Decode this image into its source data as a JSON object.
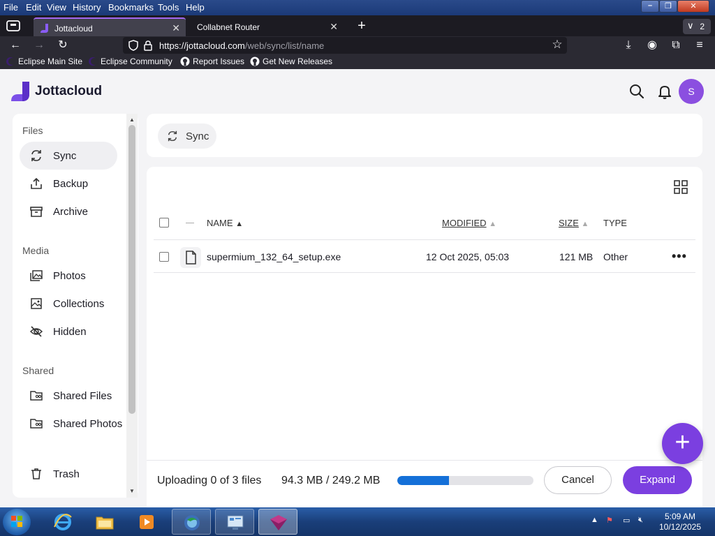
{
  "menubar": {
    "items": [
      {
        "label": "File"
      },
      {
        "label": "Edit"
      },
      {
        "label": "View"
      },
      {
        "label": "History"
      },
      {
        "label": "Bookmarks"
      },
      {
        "label": "Tools"
      },
      {
        "label": "Help"
      }
    ]
  },
  "tabs": [
    {
      "title": "Jottacloud",
      "active": true
    },
    {
      "title": "Collabnet Router",
      "active": false
    }
  ],
  "tab_count": "2",
  "urlbar": {
    "host": "https://jottacloud.com",
    "path": "/web/sync/list/name"
  },
  "bookmarks": [
    {
      "label": "Eclipse Main Site",
      "icon": "eclipse-icon"
    },
    {
      "label": "Eclipse Community",
      "icon": "eclipse-icon"
    },
    {
      "label": "Report Issues",
      "icon": "github-icon"
    },
    {
      "label": "Get New Releases",
      "icon": "github-icon"
    }
  ],
  "app": {
    "name": "Jottacloud",
    "avatar_initial": "S",
    "accent": "#7b3fe0"
  },
  "sidebar": {
    "sections": [
      {
        "title": "Files",
        "items": [
          {
            "label": "Sync",
            "icon": "sync-icon",
            "active": true
          },
          {
            "label": "Backup",
            "icon": "backup-icon"
          },
          {
            "label": "Archive",
            "icon": "archive-icon"
          }
        ]
      },
      {
        "title": "Media",
        "items": [
          {
            "label": "Photos",
            "icon": "photos-icon"
          },
          {
            "label": "Collections",
            "icon": "collections-icon"
          },
          {
            "label": "Hidden",
            "icon": "hidden-icon"
          }
        ]
      },
      {
        "title": "Shared",
        "items": [
          {
            "label": "Shared Files",
            "icon": "shared-files-icon"
          },
          {
            "label": "Shared Photos",
            "icon": "shared-photos-icon"
          }
        ]
      }
    ],
    "trash_label": "Trash"
  },
  "breadcrumb": {
    "label": "Sync"
  },
  "table": {
    "columns": {
      "name": "NAME",
      "modified": "MODIFIED",
      "size": "SIZE",
      "type": "TYPE"
    },
    "rows": [
      {
        "name": "supermium_132_64_setup.exe",
        "modified": "12 Oct 2025, 05:03",
        "size": "121 MB",
        "type": "Other"
      }
    ]
  },
  "upload": {
    "status": "Uploading 0 of 3 files",
    "amount": "94.3 MB / 249.2 MB",
    "progress_fraction": 0.378,
    "cancel_label": "Cancel",
    "expand_label": "Expand"
  },
  "fab_label": "+",
  "taskbar": {
    "time": "5:09 AM",
    "date": "10/12/2025"
  }
}
